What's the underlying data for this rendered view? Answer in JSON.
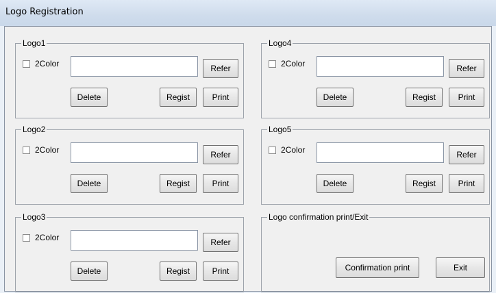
{
  "window": {
    "title": "Logo Registration"
  },
  "logos": [
    {
      "label": "Logo1",
      "two_color": "2Color",
      "refer": "Refer",
      "delete": "Delete",
      "regist": "Regist",
      "print": "Print"
    },
    {
      "label": "Logo2",
      "two_color": "2Color",
      "refer": "Refer",
      "delete": "Delete",
      "regist": "Regist",
      "print": "Print"
    },
    {
      "label": "Logo3",
      "two_color": "2Color",
      "refer": "Refer",
      "delete": "Delete",
      "regist": "Regist",
      "print": "Print"
    },
    {
      "label": "Logo4",
      "two_color": "2Color",
      "refer": "Refer",
      "delete": "Delete",
      "regist": "Regist",
      "print": "Print"
    },
    {
      "label": "Logo5",
      "two_color": "2Color",
      "refer": "Refer",
      "delete": "Delete",
      "regist": "Regist",
      "print": "Print"
    }
  ],
  "confirm_group": {
    "label": "Logo confirmation print/Exit",
    "confirm_print": "Confirmation print",
    "exit": "Exit"
  }
}
